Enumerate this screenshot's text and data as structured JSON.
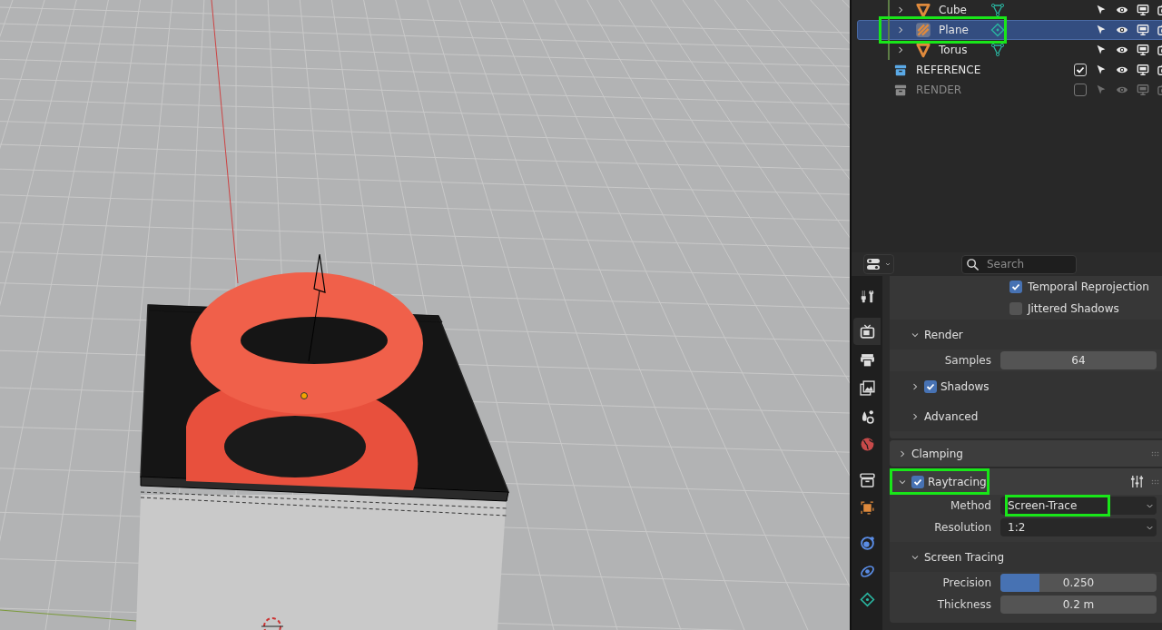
{
  "outliner": {
    "items": [
      {
        "kind": "mesh",
        "name": "Cube",
        "selected": false,
        "highlighted": false,
        "enabled": true
      },
      {
        "kind": "plane",
        "name": "Plane",
        "selected": true,
        "highlighted": true,
        "enabled": true
      },
      {
        "kind": "mesh",
        "name": "Torus",
        "selected": false,
        "highlighted": false,
        "enabled": true
      },
      {
        "kind": "collection",
        "name": "REFERENCE",
        "selected": false,
        "highlighted": false,
        "enabled": true,
        "checked": true
      },
      {
        "kind": "collection",
        "name": "RENDER",
        "selected": false,
        "highlighted": false,
        "enabled": false,
        "checked": false
      }
    ]
  },
  "properties": {
    "search": {
      "placeholder": "Search"
    },
    "tabs": [
      {
        "kind": "tool",
        "selected": false
      },
      {
        "kind": "render",
        "selected": true
      },
      {
        "kind": "output",
        "selected": false
      },
      {
        "kind": "view_layer",
        "selected": false
      },
      {
        "kind": "scene",
        "selected": false
      },
      {
        "kind": "world",
        "selected": false
      },
      {
        "kind": "collection",
        "selected": false
      },
      {
        "kind": "object",
        "selected": false
      },
      {
        "kind": "modifiers",
        "selected": false
      },
      {
        "kind": "physics",
        "selected": false
      },
      {
        "kind": "data",
        "selected": false
      }
    ],
    "rows": [
      {
        "kind": "checkbox",
        "label": "Temporal Reprojection",
        "checked": true,
        "highlighted": false
      },
      {
        "kind": "checkbox",
        "label": "Jittered Shadows",
        "checked": false,
        "highlighted": false
      },
      {
        "kind": "subpanel",
        "label": "Render",
        "expanded": true,
        "highlighted": false
      },
      {
        "kind": "number",
        "label": "Samples",
        "value": "64",
        "highlighted": false
      },
      {
        "kind": "subpanel",
        "label": "Shadows",
        "expanded": false,
        "checked": true,
        "highlighted": false
      },
      {
        "kind": "subpanel",
        "label": "Advanced",
        "expanded": false,
        "highlighted": false
      },
      {
        "kind": "panel",
        "label": "Clamping",
        "expanded": false,
        "highlighted": false
      },
      {
        "kind": "panel",
        "label": "Raytracing",
        "expanded": true,
        "checked": true,
        "highlighted": true
      },
      {
        "kind": "dropdown",
        "label": "Method",
        "value": "Screen-Trace",
        "highlighted": true
      },
      {
        "kind": "dropdown",
        "label": "Resolution",
        "value": "1:2",
        "highlighted": false
      },
      {
        "kind": "subpanel",
        "label": "Screen Tracing",
        "expanded": true,
        "highlighted": false
      },
      {
        "kind": "slider",
        "label": "Precision",
        "value": "0.250",
        "level": 0.25,
        "highlighted": false
      },
      {
        "kind": "number",
        "label": "Thickness",
        "value": "0.2 m",
        "highlighted": false
      }
    ]
  }
}
